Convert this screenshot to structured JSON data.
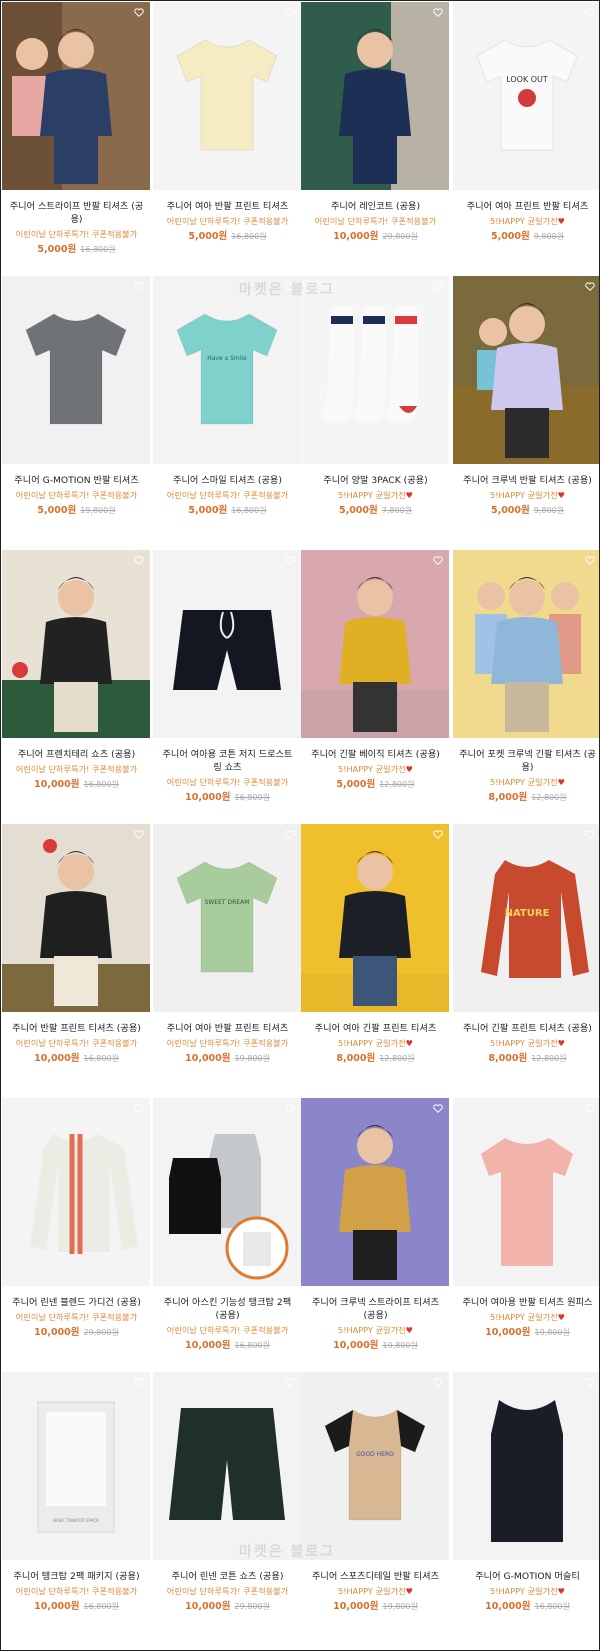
{
  "heart_icon": "heart-outline-icon",
  "watermark": "마켓은 블로그",
  "products": [
    {
      "title": "주니어 스트라이프 반팔 티셔츠 (공용)",
      "promo": "어린이날 단하루특가! 쿠폰적용불가",
      "promo_heart": false,
      "price": "5,000원",
      "original": "16,800원"
    },
    {
      "title": "주니어 여아 반팔 프린트 티셔츠",
      "promo": "어린이날 단하루특가! 쿠폰적용불가",
      "promo_heart": false,
      "price": "5,000원",
      "original": "16,800원"
    },
    {
      "title": "주니어 레인코트 (공용)",
      "promo": "어린이날 단하루특가! 쿠폰적용불가",
      "promo_heart": false,
      "price": "10,000원",
      "original": "29,800원"
    },
    {
      "title": "주니어 여아 프린트 반팔 티셔츠",
      "promo": "5!HAPPY 균일가전",
      "promo_heart": true,
      "price": "5,000원",
      "original": "9,800원"
    },
    {
      "title": "주니어 G-MOTION 반팔 티셔츠",
      "promo": "어린이날 단하루특가! 쿠폰적용불가",
      "promo_heart": false,
      "price": "5,000원",
      "original": "19,800원"
    },
    {
      "title": "주니어 스마일 티셔츠 (공용)",
      "promo": "어린이날 단하루특가! 쿠폰적용불가",
      "promo_heart": false,
      "price": "5,000원",
      "original": "16,800원"
    },
    {
      "title": "주니어 양말 3PACK (공용)",
      "promo": "5!HAPPY 균일가전",
      "promo_heart": true,
      "price": "5,000원",
      "original": "7,800원"
    },
    {
      "title": "주니어 크루넥 반팔 티셔츠 (공용)",
      "promo": "5!HAPPY 균일가전",
      "promo_heart": true,
      "price": "5,000원",
      "original": "9,800원"
    },
    {
      "title": "주니어 프렌치테리 쇼츠 (공용)",
      "promo": "어린이날 단하루특가! 쿠폰적용불가",
      "promo_heart": false,
      "price": "10,000원",
      "original": "16,800원"
    },
    {
      "title": "주니어 여아용 코튼 저지 드로스트링 쇼츠",
      "promo": "어린이날 단하루특가! 쿠폰적용불가",
      "promo_heart": false,
      "price": "10,000원",
      "original": "16,800원"
    },
    {
      "title": "주니어 긴팔 베이직 티셔츠 (공용)",
      "promo": "5!HAPPY 균일가전",
      "promo_heart": true,
      "price": "5,000원",
      "original": "12,800원"
    },
    {
      "title": "주니어 포켓 크루넥 긴팔 티셔츠 (공용)",
      "promo": "5!HAPPY 균일가전",
      "promo_heart": true,
      "price": "8,000원",
      "original": "12,800원"
    },
    {
      "title": "주니어 반팔 프린트 티셔츠 (공용)",
      "promo": "어린이날 단하루특가! 쿠폰적용불가",
      "promo_heart": false,
      "price": "10,000원",
      "original": "16,800원"
    },
    {
      "title": "주니어 여아 반팔 프린트 티셔츠",
      "promo": "어린이날 단하루특가! 쿠폰적용불가",
      "promo_heart": false,
      "price": "10,000원",
      "original": "19,800원"
    },
    {
      "title": "주니어 여아 긴팔 프린트 티셔츠",
      "promo": "5!HAPPY 균일가전",
      "promo_heart": true,
      "price": "8,000원",
      "original": "12,800원"
    },
    {
      "title": "주니어 긴팔 프린트 티셔츠 (공용)",
      "promo": "5!HAPPY 균일가전",
      "promo_heart": true,
      "price": "8,000원",
      "original": "12,800원"
    },
    {
      "title": "주니어 린넨 블렌드 가디건 (공용)",
      "promo": "어린이날 단하루특가! 쿠폰적용불가",
      "promo_heart": false,
      "price": "10,000원",
      "original": "29,800원"
    },
    {
      "title": "주니어 아스킨 기능성 탱크탑 2팩 (공용)",
      "promo": "어린이날 단하루특가! 쿠폰적용불가",
      "promo_heart": false,
      "price": "10,000원",
      "original": "16,800원"
    },
    {
      "title": "주니어 크루넥 스트라이프 티셔츠 (공용)",
      "promo": "5!HAPPY 균일가전",
      "promo_heart": true,
      "price": "10,000원",
      "original": "19,800원"
    },
    {
      "title": "주니어 여아용 반팔 티셔츠 원피스",
      "promo": "5!HAPPY 균일가전",
      "promo_heart": true,
      "price": "10,000원",
      "original": "19,800원"
    },
    {
      "title": "주니어 탱크탑 2팩 패키지 (공용)",
      "promo": "어린이날 단하루특가! 쿠폰적용불가",
      "promo_heart": false,
      "price": "10,000원",
      "original": "16,800원"
    },
    {
      "title": "주니어 린넨 코튼 쇼츠 (공용)",
      "promo": "어린이날 단하루특가! 쿠폰적용불가",
      "promo_heart": false,
      "price": "10,000원",
      "original": "29,800원"
    },
    {
      "title": "주니어 스포츠디테일 반팔 티셔츠",
      "promo": "5!HAPPY 균일가전",
      "promo_heart": true,
      "price": "10,000원",
      "original": "19,800원"
    },
    {
      "title": "주니어 G-MOTION 머슬티",
      "promo": "5!HAPPY 균일가전",
      "promo_heart": true,
      "price": "10,000원",
      "original": "16,800원"
    }
  ]
}
